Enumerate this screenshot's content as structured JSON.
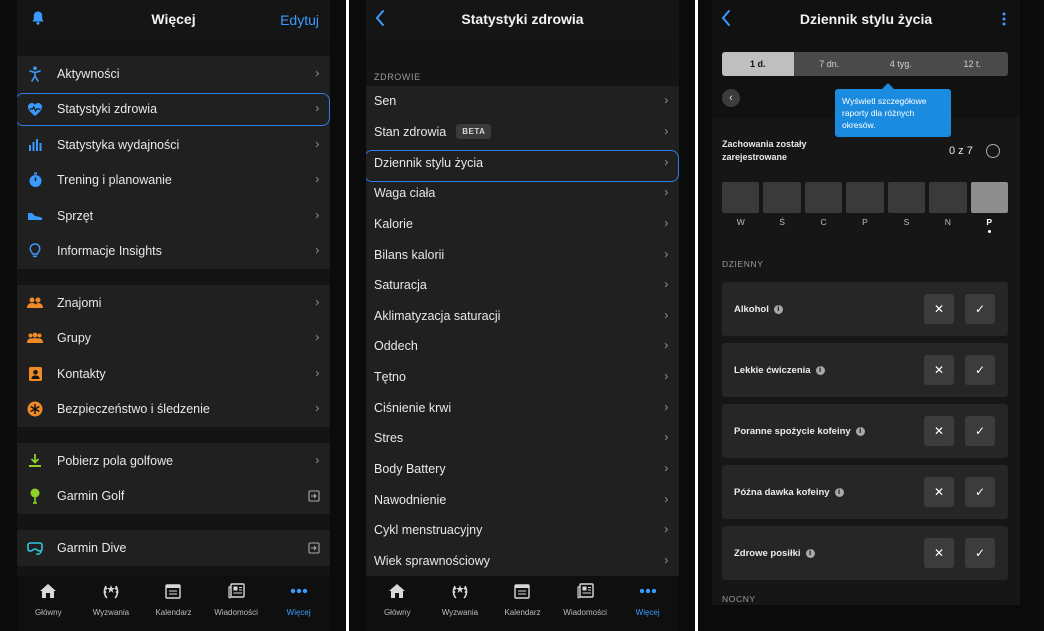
{
  "colors": {
    "accent": "#3a9bff",
    "tooltip": "#1b8be0",
    "selection_outline": "#2f7fe6",
    "background": "#141414",
    "row": "#202020"
  },
  "screen1": {
    "header": {
      "title": "Więcej",
      "edit_label": "Edytuj",
      "left_icon": "bell-icon"
    },
    "group1": [
      {
        "label": "Aktywności",
        "icon": "person-running-icon"
      },
      {
        "label": "Statystyki zdrowia",
        "icon": "heart-pulse-icon",
        "selected": true
      },
      {
        "label": "Statystyka wydajności",
        "icon": "bar-chart-icon"
      },
      {
        "label": "Trening i planowanie",
        "icon": "stopwatch-icon"
      },
      {
        "label": "Sprzęt",
        "icon": "shoe-icon"
      },
      {
        "label": "Informacje Insights",
        "icon": "lightbulb-icon"
      }
    ],
    "group2": [
      {
        "label": "Znajomi",
        "icon": "friends-icon"
      },
      {
        "label": "Grupy",
        "icon": "groups-icon"
      },
      {
        "label": "Kontakty",
        "icon": "contacts-icon"
      },
      {
        "label": "Bezpieczeństwo i śledzenie",
        "icon": "safety-icon"
      }
    ],
    "group3": [
      {
        "label": "Pobierz pola golfowe",
        "icon": "download-icon"
      },
      {
        "label": "Garmin Golf",
        "icon": "golf-icon",
        "external": true
      }
    ],
    "group4": [
      {
        "label": "Garmin Dive",
        "icon": "dive-mask-icon",
        "external": true
      }
    ]
  },
  "screen2": {
    "header": {
      "title": "Statystyki zdrowia"
    },
    "section_label": "ZDROWIE",
    "items": [
      {
        "label": "Sen"
      },
      {
        "label": "Stan zdrowia",
        "badge": "BETA"
      },
      {
        "label": "Dziennik stylu życia",
        "selected": true
      },
      {
        "label": "Waga ciała"
      },
      {
        "label": "Kalorie"
      },
      {
        "label": "Bilans kalorii"
      },
      {
        "label": "Saturacja"
      },
      {
        "label": "Aklimatyzacja saturacji"
      },
      {
        "label": "Oddech"
      },
      {
        "label": "Tętno"
      },
      {
        "label": "Ciśnienie krwi"
      },
      {
        "label": "Stres"
      },
      {
        "label": "Body Battery"
      },
      {
        "label": "Nawodnienie"
      },
      {
        "label": "Cykl menstruacyjny"
      },
      {
        "label": "Wiek sprawnościowy"
      }
    ]
  },
  "screen3": {
    "header": {
      "title": "Dziennik stylu życia"
    },
    "ranges": [
      "1 d.",
      "7 dn.",
      "4 tyg.",
      "12 t."
    ],
    "active_range": "1 d.",
    "tooltip": "Wyświetl szczegółowe raporty dla różnych okresów.",
    "recorded_label": "Zachowania zostały zarejestrowane",
    "recorded_count": "0 z 7",
    "days": [
      "W",
      "Ś",
      "C",
      "P",
      "S",
      "N",
      "P"
    ],
    "current_day_index": 6,
    "section_daily": "DZIENNY",
    "behaviors": [
      "Alkohol",
      "Lekkie ćwiczenia",
      "Poranne spożycie kofeiny",
      "Późna dawka kofeiny",
      "Zdrowe posiłki"
    ],
    "section_night": "NOCNY",
    "x_symbol": "✕",
    "check_symbol": "✓",
    "info_symbol": "i"
  },
  "tabbar": [
    {
      "label": "Główny",
      "icon": "home-icon"
    },
    {
      "label": "Wyzwania",
      "icon": "laurel-icon"
    },
    {
      "label": "Kalendarz",
      "icon": "calendar-icon"
    },
    {
      "label": "Wiadomości",
      "icon": "news-icon"
    },
    {
      "label": "Więcej",
      "icon": "more-dots-icon",
      "active": true
    }
  ],
  "chevron": "›"
}
